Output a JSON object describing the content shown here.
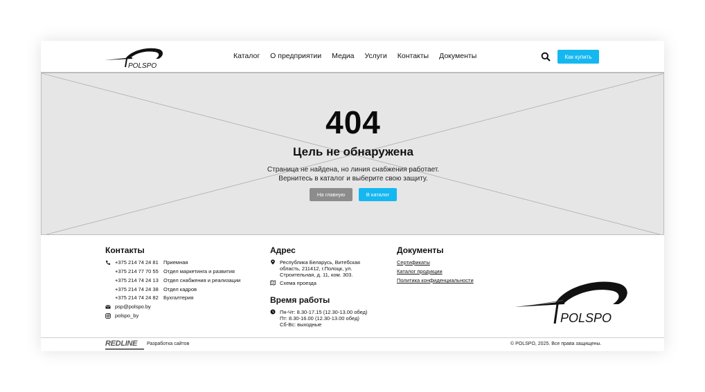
{
  "header": {
    "logo_text": "POLSPO",
    "nav": [
      "Каталог",
      "О предприятии",
      "Медиа",
      "Услуги",
      "Контакты",
      "Документы"
    ],
    "buy_label": "Как купить"
  },
  "hero": {
    "code": "404",
    "title": "Цель не обнаружена",
    "text_line1": "Страница не найдена, но линия снабжения работает.",
    "text_line2": "Вернитесь в каталог и выберите свою защиту.",
    "home_label": "На главную",
    "catalog_label": "В каталог"
  },
  "footer": {
    "contacts_title": "Контакты",
    "phones": [
      {
        "phone": "+375 214 74 24 81",
        "dept": "Приемная"
      },
      {
        "phone": "+375 214 77 70 55",
        "dept": "Отдел маркетинга и развития"
      },
      {
        "phone": "+375 214 74 24 13",
        "dept": "Отдел снабжения и реализации"
      },
      {
        "phone": "+375 214 74 24 38",
        "dept": "Отдел кадров"
      },
      {
        "phone": "+375 214 74 24 82",
        "dept": "Бухгалтерия"
      }
    ],
    "email": "psp@polspo.by",
    "instagram": "polspo_by",
    "address_title": "Адрес",
    "address_lines": [
      "Республика Беларусь, Витебская",
      "область, 211412, г.Полоцк, ул.",
      "Строительная, д. 11, ком. 303."
    ],
    "map_link": "Схема проезда",
    "hours_title": "Время работы",
    "hours_lines": [
      "Пн-Чт: 8.30-17.15 (12.30-13.00 обед)",
      "Пт: 8.30-16.00 (12.30-13.00 обед)",
      "Сб-Вс: выходные"
    ],
    "docs_title": "Документы",
    "docs": [
      "Сертификаты",
      "Каталог продукции",
      "Политика конфиденциальности"
    ],
    "logo_text": "POLSPO"
  },
  "bottom": {
    "dev_brand": "REDLINE",
    "dev_text": "Разработка сайтов",
    "copyright": "© POLSPO, 2025. Все права защищены."
  },
  "colors": {
    "accent": "#15b7f0",
    "secondary_button": "#8c8c8c",
    "hero_bg": "#e6e6e6"
  }
}
